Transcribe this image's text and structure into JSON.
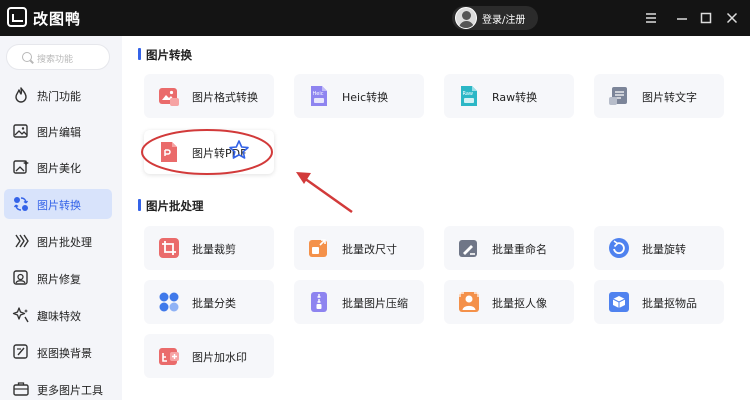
{
  "app": {
    "title": "改图鸭",
    "login_label": "登录/注册"
  },
  "search": {
    "placeholder": "搜索功能"
  },
  "sidebar": {
    "items": [
      {
        "label": "热门功能",
        "icon": "flame-icon"
      },
      {
        "label": "图片编辑",
        "icon": "image-edit-icon"
      },
      {
        "label": "图片美化",
        "icon": "beautify-icon"
      },
      {
        "label": "图片转换",
        "icon": "convert-icon",
        "active": true
      },
      {
        "label": "图片批处理",
        "icon": "batch-icon"
      },
      {
        "label": "照片修复",
        "icon": "repair-icon"
      },
      {
        "label": "趣味特效",
        "icon": "sparkle-icon"
      },
      {
        "label": "抠图换背景",
        "icon": "cutout-icon"
      },
      {
        "label": "更多图片工具",
        "icon": "toolbox-icon"
      }
    ]
  },
  "sections": {
    "convert": {
      "title": "图片转换",
      "cards": [
        {
          "label": "图片格式转换",
          "icon": "format-convert-icon"
        },
        {
          "label": "Heic转换",
          "icon": "heic-icon",
          "badge": "Heic"
        },
        {
          "label": "Raw转换",
          "icon": "raw-icon",
          "badge": "Raw"
        },
        {
          "label": "图片转文字",
          "icon": "image-to-text-icon"
        },
        {
          "label": "图片转PDF",
          "icon": "image-to-pdf-icon"
        }
      ]
    },
    "batch": {
      "title": "图片批处理",
      "cards": [
        {
          "label": "批量裁剪",
          "icon": "crop-icon"
        },
        {
          "label": "批量改尺寸",
          "icon": "resize-icon"
        },
        {
          "label": "批量重命名",
          "icon": "rename-icon"
        },
        {
          "label": "批量旋转",
          "icon": "rotate-icon"
        },
        {
          "label": "批量分类",
          "icon": "classify-icon"
        },
        {
          "label": "批量图片压缩",
          "icon": "compress-icon"
        },
        {
          "label": "批量抠人像",
          "icon": "portrait-cutout-icon"
        },
        {
          "label": "批量抠物品",
          "icon": "object-cutout-icon"
        },
        {
          "label": "图片加水印",
          "icon": "watermark-icon"
        }
      ]
    }
  },
  "colors": {
    "accent": "#3463e8",
    "titlebar": "#141414",
    "annotation": "#d23a3a"
  }
}
